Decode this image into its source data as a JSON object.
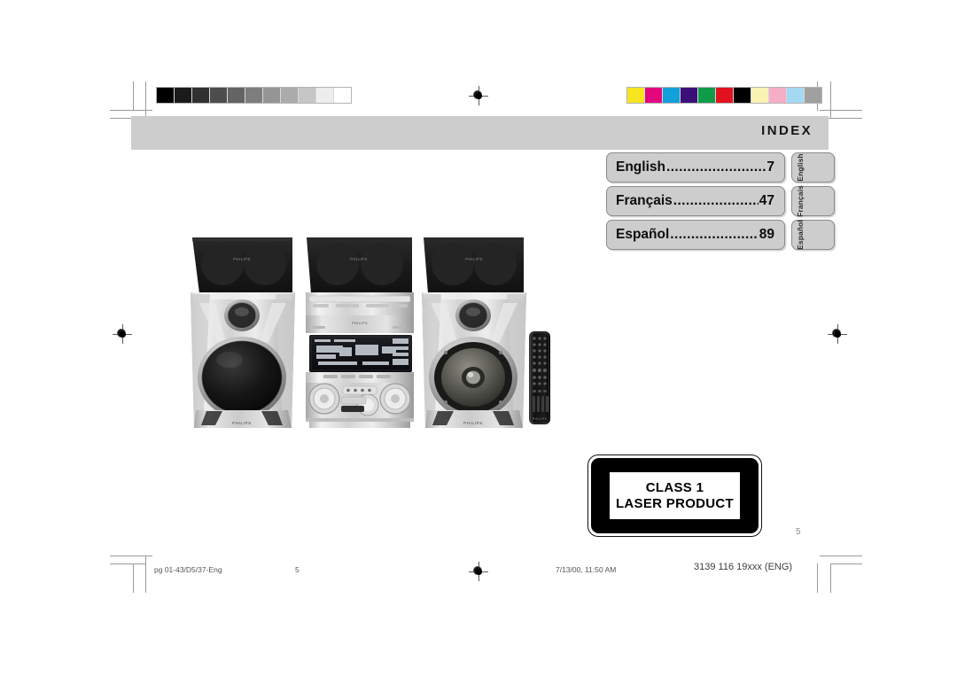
{
  "document": {
    "header_title": "INDEX",
    "page_number": "5"
  },
  "index": {
    "rows": [
      {
        "language": "English",
        "dots": "..............................",
        "page": "7",
        "tab_label": "English"
      },
      {
        "language": "Français",
        "dots": "........................",
        "page": "47",
        "tab_label": "Français"
      },
      {
        "language": "Español",
        "dots": ".........................",
        "page": "89",
        "tab_label": "Español"
      }
    ]
  },
  "laser_label": {
    "line1": "CLASS 1",
    "line2": "LASER PRODUCT"
  },
  "footer": {
    "file": "pg 01-43/D5/37-Eng",
    "page": "5",
    "date": "7/13/00, 11:50 AM",
    "code": "3139 116 19xxx (ENG)"
  },
  "calibration": {
    "grayscale": [
      "#000000",
      "#1b1b1b",
      "#313131",
      "#4d4d4d",
      "#646464",
      "#7d7d7d",
      "#959595",
      "#ababab",
      "#c6c6c6",
      "#ededed",
      "#ffffff"
    ],
    "colorbar": [
      "#f7e520",
      "#e3077f",
      "#139fdc",
      "#3a1078",
      "#0f9b4a",
      "#e2111f",
      "#000000",
      "#f9f3b4",
      "#f6aec7",
      "#a5d8f3",
      "#a0a0a0"
    ]
  },
  "photo": {
    "brand": "PHILIPS",
    "alt": "Philips mini hi-fi audio system with two speakers, center deck and remote control"
  }
}
